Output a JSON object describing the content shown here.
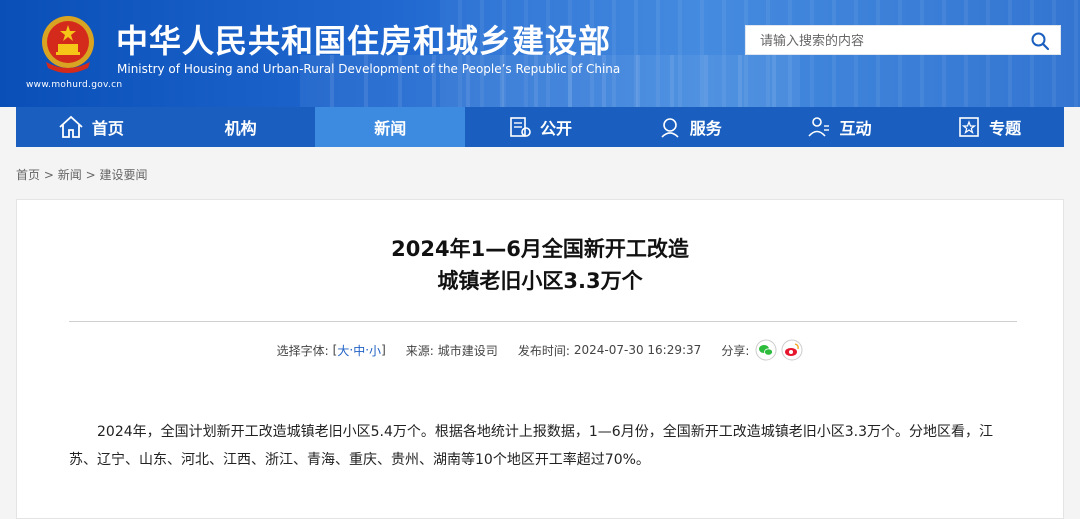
{
  "header": {
    "site_url": "www.mohurd.gov.cn",
    "title_cn": "中华人民共和国住房和城乡建设部",
    "title_en": "Ministry of Housing and Urban-Rural Development of the People’s Republic of China",
    "search_placeholder": "请输入搜索的内容"
  },
  "nav": [
    {
      "label": "首页",
      "icon": "home-icon"
    },
    {
      "label": "机构",
      "icon": ""
    },
    {
      "label": "新闻",
      "icon": "",
      "active": true
    },
    {
      "label": "公开",
      "icon": "document-icon"
    },
    {
      "label": "服务",
      "icon": "service-icon"
    },
    {
      "label": "互动",
      "icon": "interaction-icon"
    },
    {
      "label": "专题",
      "icon": "topic-icon"
    }
  ],
  "breadcrumb": [
    "首页",
    "新闻",
    "建设要闻"
  ],
  "article": {
    "title_line1": "2024年1—6月全国新开工改造",
    "title_line2": "城镇老旧小区3.3万个",
    "font_label": "选择字体:",
    "size_open": "[",
    "size_large": "大",
    "size_mid": "中",
    "size_small": "小",
    "size_close": "]",
    "source_label": "来源:",
    "source": "城市建设司",
    "time_label": "发布时间:",
    "time": "2024-07-30 16:29:37",
    "share_label": "分享:",
    "body": "2024年，全国计划新开工改造城镇老旧小区5.4万个。根据各地统计上报数据，1—6月份，全国新开工改造城镇老旧小区3.3万个。分地区看，江苏、辽宁、山东、河北、江西、浙江、青海、重庆、贵州、湖南等10个地区开工率超过70%。"
  },
  "colors": {
    "nav_bg": "#1a5fbf",
    "nav_active": "#3d8be0",
    "link": "#2061c5"
  }
}
